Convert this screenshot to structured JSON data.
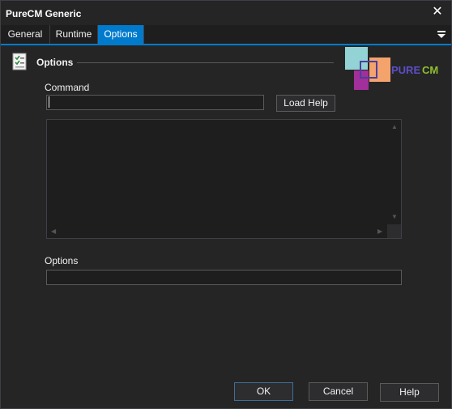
{
  "window": {
    "title": "PureCM Generic"
  },
  "tabs": [
    {
      "label": "General",
      "active": false
    },
    {
      "label": "Runtime",
      "active": false
    },
    {
      "label": "Options",
      "active": true
    }
  ],
  "section": {
    "title": "Options"
  },
  "logo": {
    "text_pure": "PURE",
    "text_cm": "CM"
  },
  "command": {
    "label": "Command",
    "value": ""
  },
  "load_help_label": "Load Help",
  "help_memo": {
    "value": ""
  },
  "options": {
    "label": "Options",
    "value": ""
  },
  "footer": {
    "ok_label": "OK",
    "cancel_label": "Cancel",
    "help_label": "Help"
  },
  "colors": {
    "accent": "#007acc",
    "background": "#252526",
    "field": "#1e1e1e"
  },
  "icons": [
    "close-icon",
    "tab-menu-icon",
    "checklist-icon"
  ]
}
